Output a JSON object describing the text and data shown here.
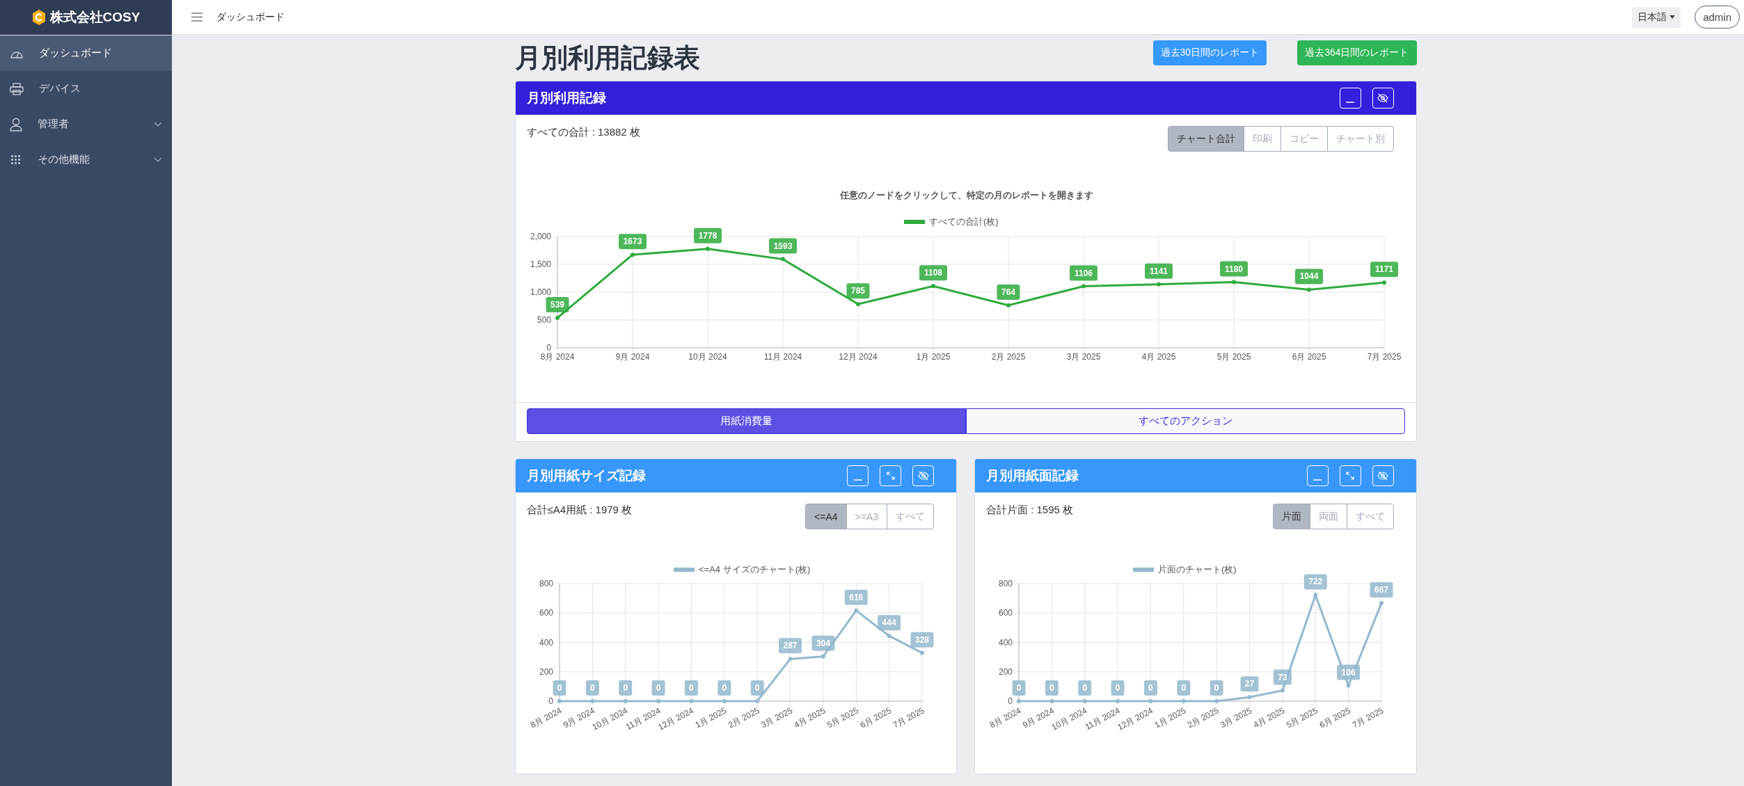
{
  "sidebar": {
    "brand": "株式会社COSY",
    "items": [
      {
        "label": "ダッシュボード",
        "selected": true,
        "expandable": false
      },
      {
        "label": "デバイス",
        "selected": false,
        "expandable": false
      },
      {
        "label": "管理者",
        "selected": false,
        "expandable": true
      },
      {
        "label": "その他機能",
        "selected": false,
        "expandable": true
      }
    ]
  },
  "topbar": {
    "breadcrumb": "ダッシュボード",
    "language": "日本語",
    "user": "admin"
  },
  "page": {
    "title": "月別利用記録表",
    "buttons": [
      {
        "label": "過去30日間のレポート",
        "kind": "primary"
      },
      {
        "label": "過去364日間のレポート",
        "kind": "success"
      }
    ]
  },
  "panels": [
    {
      "kind": "main",
      "title": "月別利用記録",
      "expandable": false,
      "total": "すべての合計 : 13882 枚",
      "toggles": [
        {
          "label": "チャート合計",
          "selected": true
        },
        {
          "label": "印刷",
          "selected": false
        },
        {
          "label": "コピー",
          "selected": false
        },
        {
          "label": "チャート別",
          "selected": false
        }
      ],
      "chart_data": {
        "type": "line",
        "title": "任意のノードをクリックして、特定の月のレポートを開きます",
        "categories": [
          "8月 2024",
          "9月 2024",
          "10月 2024",
          "11月 2024",
          "12月 2024",
          "1月 2025",
          "2月 2025",
          "3月 2025",
          "4月 2025",
          "5月 2025",
          "6月 2025",
          "7月 2025"
        ],
        "grid": true,
        "series": [
          {
            "name": "すべての合計(枚)",
            "color": "#2eaa3c",
            "marker": true,
            "values": [
              539,
              1673,
              1778,
              1593,
              785,
              1108,
              764,
              1106,
              1141,
              1180,
              1044,
              1171
            ]
          }
        ],
        "ylim": [
          0,
          2000
        ],
        "yticks": [
          0,
          500,
          {
            "value": 1000,
            "label": "1,000"
          },
          {
            "value": 1500,
            "label": "1,500"
          },
          {
            "value": 2000,
            "label": "2,000"
          }
        ],
        "data_labels": true
      },
      "tabs": [
        {
          "label": "用紙消費量",
          "selected": true
        },
        {
          "label": "すべてのアクション",
          "selected": false
        }
      ]
    },
    {
      "kind": "small",
      "title": "月別用紙サイズ記録",
      "expandable": true,
      "total": "合計≤A4用紙 : 1979 枚",
      "toggles": [
        {
          "label": "<=A4",
          "selected": true
        },
        {
          "label": ">=A3",
          "selected": false
        },
        {
          "label": "すべて",
          "selected": false
        }
      ],
      "chart_data": {
        "type": "line",
        "categories": [
          "8月 2024",
          "9月 2024",
          "10月 2024",
          "11月 2024",
          "12月 2024",
          "1月 2025",
          "2月 2025",
          "3月 2025",
          "4月 2025",
          "5月 2025",
          "6月 2025",
          "7月 2025"
        ],
        "grid": true,
        "series": [
          {
            "name": "<=A4 サイズのチャート(枚)",
            "color": "#93b9cd",
            "marker": true,
            "values": [
              0,
              0,
              0,
              0,
              0,
              0,
              0,
              287,
              304,
              616,
              444,
              328
            ]
          }
        ],
        "ylim": [
          0,
          800
        ],
        "yticks": [
          0,
          200,
          400,
          600,
          800
        ],
        "data_labels": true
      }
    },
    {
      "kind": "small",
      "title": "月別用紙面記録",
      "expandable": true,
      "total": "合計片面 : 1595 枚",
      "toggles": [
        {
          "label": "片面",
          "selected": true
        },
        {
          "label": "両面",
          "selected": false
        },
        {
          "label": "すべて",
          "selected": false
        }
      ],
      "chart_data": {
        "type": "line",
        "categories": [
          "8月 2024",
          "9月 2024",
          "10月 2024",
          "11月 2024",
          "12月 2024",
          "1月 2025",
          "2月 2025",
          "3月 2025",
          "4月 2025",
          "5月 2025",
          "6月 2025",
          "7月 2025"
        ],
        "grid": true,
        "series": [
          {
            "name": "片面のチャート(枚)",
            "color": "#93b9cd",
            "marker": true,
            "values": [
              0,
              0,
              0,
              0,
              0,
              0,
              0,
              27,
              73,
              722,
              106,
              667
            ]
          }
        ],
        "ylim": [
          0,
          800
        ],
        "yticks": [
          0,
          200,
          400,
          600,
          800
        ],
        "data_labels": true
      }
    }
  ]
}
